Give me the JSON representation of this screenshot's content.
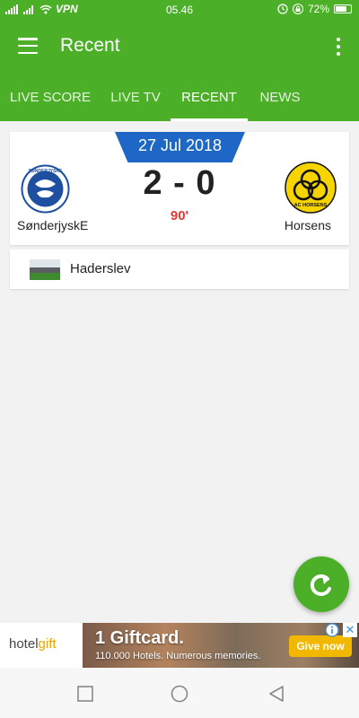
{
  "status_bar": {
    "vpn": "VPN",
    "time": "05.46",
    "battery": "72%"
  },
  "app_bar": {
    "title": "Recent"
  },
  "tabs": [
    {
      "label": "LIVE SCORE"
    },
    {
      "label": "LIVE TV"
    },
    {
      "label": "RECENT",
      "active": true
    },
    {
      "label": "NEWS"
    }
  ],
  "match": {
    "date": "27 Jul 2018",
    "home_team": "SønderjyskE",
    "away_team": "Horsens",
    "score": "2 - 0",
    "minute": "90'",
    "away_logo_text": "AC HORSENS",
    "home_logo_text": "SØNDERJYSKE"
  },
  "venue": {
    "name": "Haderslev"
  },
  "ad": {
    "brand_prefix": "hotel",
    "brand_suffix": "gift",
    "headline": "1 Giftcard.",
    "subline": "110.000 Hotels.  Numerous memories.",
    "cta": "Give now",
    "close": "✕"
  },
  "colors": {
    "primary": "#4caf28",
    "date_banner": "#1e67c6",
    "minute": "#e53935",
    "cta": "#f2b800"
  }
}
